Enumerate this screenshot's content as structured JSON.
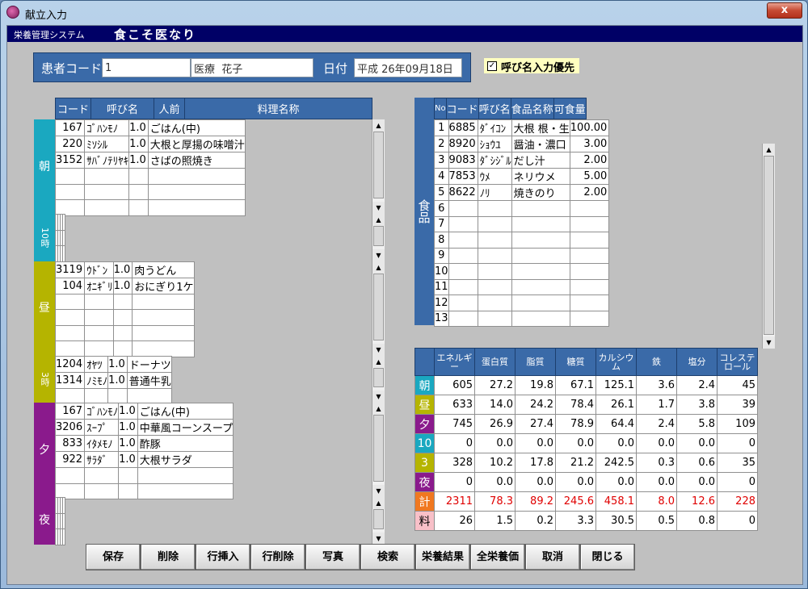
{
  "window": {
    "title": "献立入力",
    "close_label": "x"
  },
  "system": {
    "label": "栄養管理システム",
    "name": "食こそ医なり"
  },
  "patient": {
    "code_label": "患者コード",
    "code_value": "1",
    "name_value": "医療  花子",
    "date_label": "日付",
    "date_value": "平成 26年09月18日"
  },
  "priority": {
    "label": "呼び名入力優先",
    "checked": "✓"
  },
  "meal_grid": {
    "headers": [
      "コード",
      "呼び名",
      "人前",
      "料理名称"
    ],
    "sections": [
      {
        "label": "朝",
        "color": "#1aa8c0",
        "rows": [
          {
            "code": "167",
            "yobi": "ｺﾞﾊﾝﾓﾉ",
            "nin": "1.0",
            "name": "ごはん(中)"
          },
          {
            "code": "220",
            "yobi": "ﾐｿｼﾙ",
            "nin": "1.0",
            "name": "大根と厚揚の味噌汁"
          },
          {
            "code": "3152",
            "yobi": "ｻﾊﾞﾉﾃﾘﾔｷ",
            "nin": "1.0",
            "name": "さばの照焼き"
          },
          {
            "code": "",
            "yobi": "",
            "nin": "",
            "name": ""
          },
          {
            "code": "",
            "yobi": "",
            "nin": "",
            "name": ""
          },
          {
            "code": "",
            "yobi": "",
            "nin": "",
            "name": ""
          }
        ]
      },
      {
        "label": "10時",
        "color": "#1aa8c0",
        "small": true,
        "rows": [
          {
            "code": "",
            "yobi": "",
            "nin": "",
            "name": ""
          },
          {
            "code": "",
            "yobi": "",
            "nin": "",
            "name": ""
          },
          {
            "code": "",
            "yobi": "",
            "nin": "",
            "name": ""
          }
        ]
      },
      {
        "label": "昼",
        "color": "#b5b400",
        "rows": [
          {
            "code": "3119",
            "yobi": "ｳﾄﾞﾝ",
            "nin": "1.0",
            "name": "肉うどん"
          },
          {
            "code": "104",
            "yobi": "ｵﾆｷﾞﾘ",
            "nin": "1.0",
            "name": "おにぎり1ケ"
          },
          {
            "code": "",
            "yobi": "",
            "nin": "",
            "name": ""
          },
          {
            "code": "",
            "yobi": "",
            "nin": "",
            "name": ""
          },
          {
            "code": "",
            "yobi": "",
            "nin": "",
            "name": ""
          },
          {
            "code": "",
            "yobi": "",
            "nin": "",
            "name": ""
          }
        ]
      },
      {
        "label": "3時",
        "color": "#b5b400",
        "small": true,
        "rows": [
          {
            "code": "1204",
            "yobi": "ｵﾔﾂ",
            "nin": "1.0",
            "name": "ドーナツ"
          },
          {
            "code": "1314",
            "yobi": "ﾉﾐﾓﾉ",
            "nin": "1.0",
            "name": "普通牛乳"
          },
          {
            "code": "",
            "yobi": "",
            "nin": "",
            "name": ""
          }
        ]
      },
      {
        "label": "夕",
        "color": "#8a1a8c",
        "rows": [
          {
            "code": "167",
            "yobi": "ｺﾞﾊﾝﾓﾉ",
            "nin": "1.0",
            "name": "ごはん(中)"
          },
          {
            "code": "3206",
            "yobi": "ｽｰﾌﾟ",
            "nin": "1.0",
            "name": "中華風コーンスープ"
          },
          {
            "code": "833",
            "yobi": "ｲﾀﾒﾓﾉ",
            "nin": "1.0",
            "name": "酢豚"
          },
          {
            "code": "922",
            "yobi": "ｻﾗﾀﾞ",
            "nin": "1.0",
            "name": "大根サラダ"
          },
          {
            "code": "",
            "yobi": "",
            "nin": "",
            "name": ""
          },
          {
            "code": "",
            "yobi": "",
            "nin": "",
            "name": ""
          }
        ]
      },
      {
        "label": "夜",
        "color": "#8a1a8c",
        "rows": [
          {
            "code": "",
            "yobi": "",
            "nin": "",
            "name": ""
          },
          {
            "code": "",
            "yobi": "",
            "nin": "",
            "name": ""
          },
          {
            "code": "",
            "yobi": "",
            "nin": "",
            "name": ""
          }
        ]
      }
    ]
  },
  "food_grid": {
    "side_label": "食品",
    "headers": [
      "No",
      "コード",
      "呼び名",
      "食品名称",
      "可食量"
    ],
    "rows": [
      {
        "no": "1",
        "code": "6885",
        "yobi": "ﾀﾞｲｺﾝ",
        "name": "大根  根・生",
        "amt": "100.00"
      },
      {
        "no": "2",
        "code": "8920",
        "yobi": "ｼｮｳﾕ",
        "name": "醤油・濃口",
        "amt": "3.00"
      },
      {
        "no": "3",
        "code": "9083",
        "yobi": "ﾀﾞｼｼﾞﾙ",
        "name": "だし汁",
        "amt": "2.00"
      },
      {
        "no": "4",
        "code": "7853",
        "yobi": "ｳﾒ",
        "name": "ネリウメ",
        "amt": "5.00"
      },
      {
        "no": "5",
        "code": "8622",
        "yobi": "ﾉﾘ",
        "name": "焼きのり",
        "amt": "2.00"
      },
      {
        "no": "6",
        "code": "",
        "yobi": "",
        "name": "",
        "amt": ""
      },
      {
        "no": "7",
        "code": "",
        "yobi": "",
        "name": "",
        "amt": ""
      },
      {
        "no": "8",
        "code": "",
        "yobi": "",
        "name": "",
        "amt": ""
      },
      {
        "no": "9",
        "code": "",
        "yobi": "",
        "name": "",
        "amt": ""
      },
      {
        "no": "10",
        "code": "",
        "yobi": "",
        "name": "",
        "amt": ""
      },
      {
        "no": "11",
        "code": "",
        "yobi": "",
        "name": "",
        "amt": ""
      },
      {
        "no": "12",
        "code": "",
        "yobi": "",
        "name": "",
        "amt": ""
      },
      {
        "no": "13",
        "code": "",
        "yobi": "",
        "name": "",
        "amt": ""
      }
    ]
  },
  "nutrition": {
    "headers": [
      "エネルギー",
      "蛋白質",
      "脂質",
      "糖質",
      "カルシウム",
      "鉄",
      "塩分",
      "コレステロール"
    ],
    "rows": [
      {
        "label": "朝",
        "color": "#1aa8c0",
        "values": [
          "605",
          "27.2",
          "19.8",
          "67.1",
          "125.1",
          "3.6",
          "2.4",
          "45"
        ]
      },
      {
        "label": "昼",
        "color": "#b5b400",
        "values": [
          "633",
          "14.0",
          "24.2",
          "78.4",
          "26.1",
          "1.7",
          "3.8",
          "39"
        ]
      },
      {
        "label": "夕",
        "color": "#8a1a8c",
        "values": [
          "745",
          "26.9",
          "27.4",
          "78.9",
          "64.4",
          "2.4",
          "5.8",
          "109"
        ]
      },
      {
        "label": "10",
        "color": "#1aa8c0",
        "values": [
          "0",
          "0.0",
          "0.0",
          "0.0",
          "0.0",
          "0.0",
          "0.0",
          "0"
        ]
      },
      {
        "label": "3",
        "color": "#b5b400",
        "values": [
          "328",
          "10.2",
          "17.8",
          "21.2",
          "242.5",
          "0.3",
          "0.6",
          "35"
        ]
      },
      {
        "label": "夜",
        "color": "#8a1a8c",
        "values": [
          "0",
          "0.0",
          "0.0",
          "0.0",
          "0.0",
          "0.0",
          "0.0",
          "0"
        ]
      },
      {
        "label": "計",
        "color": "#f07820",
        "red": true,
        "values": [
          "2311",
          "78.3",
          "89.2",
          "245.6",
          "458.1",
          "8.0",
          "12.6",
          "228"
        ]
      },
      {
        "label": "料",
        "color": "#f8c0c8",
        "dark": true,
        "values": [
          "26",
          "1.5",
          "0.2",
          "3.3",
          "30.5",
          "0.5",
          "0.8",
          "0"
        ]
      }
    ]
  },
  "buttons": [
    "保存",
    "削除",
    "行挿入",
    "行削除",
    "写真",
    "検索",
    "栄養結果",
    "全栄養価",
    "取消",
    "閉じる"
  ]
}
